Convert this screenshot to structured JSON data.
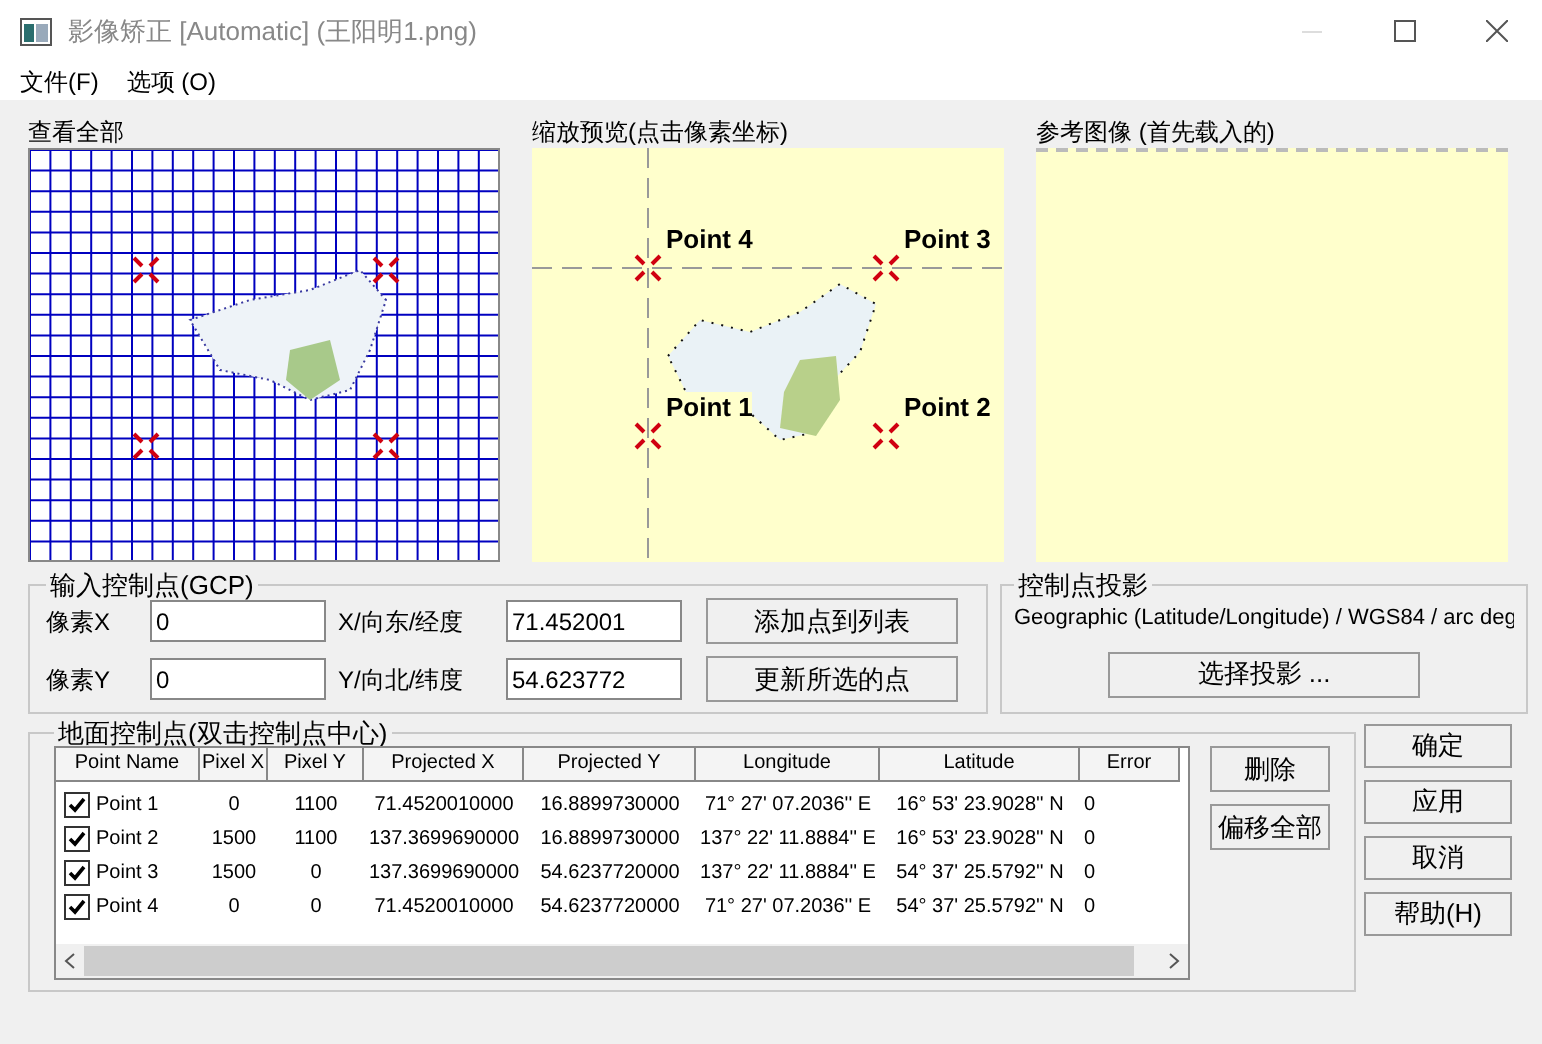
{
  "window": {
    "title": "影像矫正 [Automatic] (王阳明1.png)"
  },
  "menu": [
    "文件(F)",
    "选项 (O)"
  ],
  "overview": {
    "title": "查看全部"
  },
  "preview": {
    "title": "缩放预览(点击像素坐标)",
    "points": [
      "Point 4",
      "Point 3",
      "Point 1",
      "Point 2"
    ]
  },
  "reference": {
    "title": "参考图像 (首先载入的)"
  },
  "gcp_input": {
    "title": "输入控制点(GCP)",
    "fields": [
      {
        "label": "像素X",
        "value": "0"
      },
      {
        "label": "X/向东/经度",
        "value": "71.452001"
      },
      {
        "label": "像素Y",
        "value": "0"
      },
      {
        "label": "Y/向北/纬度",
        "value": "54.623772"
      }
    ],
    "buttons": [
      "添加点到列表",
      "更新所选的点"
    ]
  },
  "projection": {
    "title": "控制点投影",
    "text": "Geographic (Latitude/Longitude) / WGS84 / arc deg",
    "button": "选择投影 ..."
  },
  "gcp_table": {
    "title": "地面控制点(双击控制点中心)",
    "columns": [
      "Point Name",
      "Pixel X",
      "Pixel Y",
      "Projected X",
      "Projected Y",
      "Longitude",
      "Latitude",
      "Error"
    ],
    "rows": [
      {
        "checked": true,
        "cells": [
          "Point 1",
          "0",
          "1100",
          "71.4520010000",
          "16.8899730000",
          "71° 27' 07.2036'' E",
          "16° 53' 23.9028'' N",
          "0"
        ]
      },
      {
        "checked": true,
        "cells": [
          "Point 2",
          "1500",
          "1100",
          "137.3699690000",
          "16.8899730000",
          "137° 22' 11.8884'' E",
          "16° 53' 23.9028'' N",
          "0"
        ]
      },
      {
        "checked": true,
        "cells": [
          "Point 3",
          "1500",
          "0",
          "137.3699690000",
          "54.6237720000",
          "137° 22' 11.8884'' E",
          "54° 37' 25.5792'' N",
          "0"
        ]
      },
      {
        "checked": true,
        "cells": [
          "Point 4",
          "0",
          "0",
          "71.4520010000",
          "54.6237720000",
          "71° 27' 07.2036'' E",
          "54° 37' 25.5792'' N",
          "0"
        ]
      }
    ],
    "buttons": [
      "删除",
      "偏移全部"
    ]
  },
  "dialog_buttons": [
    "确定",
    "应用",
    "取消",
    "帮助(H)"
  ]
}
